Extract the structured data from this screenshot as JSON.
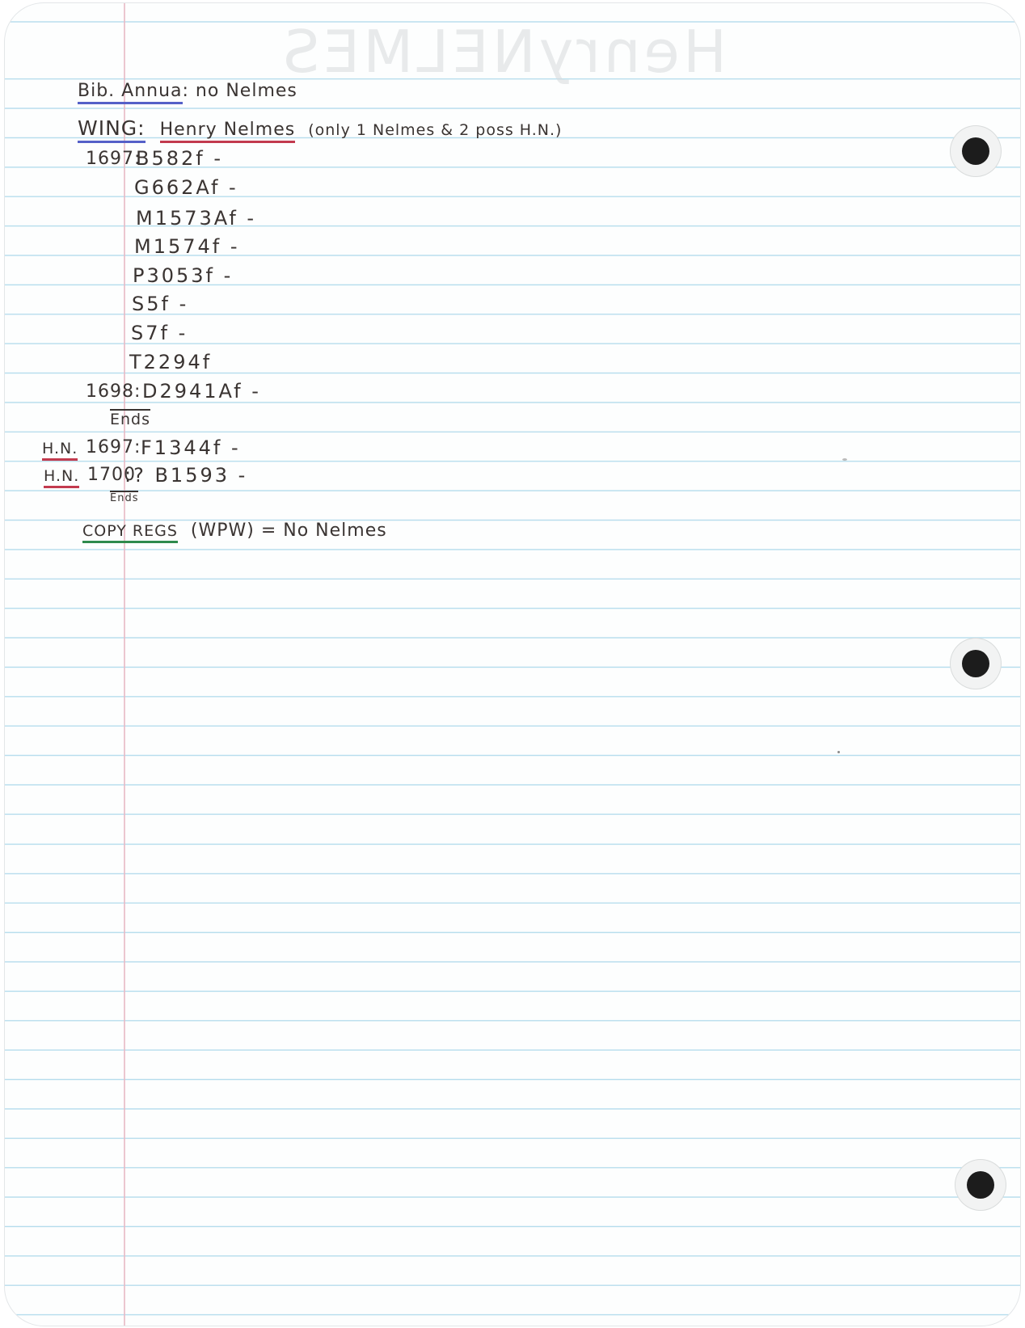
{
  "header": {
    "ghost_text": "HenryNELMES"
  },
  "lines": {
    "bib_label": "Bib. Annua",
    "bib_rest": ": no Nelmes",
    "wing_label": "WING:",
    "wing_name": "Henry Nelmes",
    "wing_note": "(only 1 Nelmes & 2 poss H.N.)",
    "year_1697": "1697:",
    "entries_1697": [
      "B582f -",
      "G662Af -",
      "M1573Af -",
      "M1574f -",
      "P3053f -",
      "S5f -",
      "S7f -",
      "T2294f"
    ],
    "year_1698": "1698:",
    "entry_1698": "D2941Af -",
    "ends_1": "Ends",
    "hn_1_label": "H.N.",
    "hn_1_year": "1697:",
    "hn_1_entry": "F1344f -",
    "hn_2_label": "H.N.",
    "hn_2_year": "1700",
    "hn_2_entry": ":? B1593 -",
    "ends_2": "Ends",
    "copy_label": "COPY REGS",
    "copy_rest": "(WPW) = No Nelmes"
  },
  "colors": {
    "ink": "#3a3432",
    "underline_blue": "#5560c8",
    "underline_red": "#c23a4e",
    "underline_green": "#2f8a4c",
    "rule_line": "#a9d7ea",
    "margin_line": "#e7b9c4"
  }
}
